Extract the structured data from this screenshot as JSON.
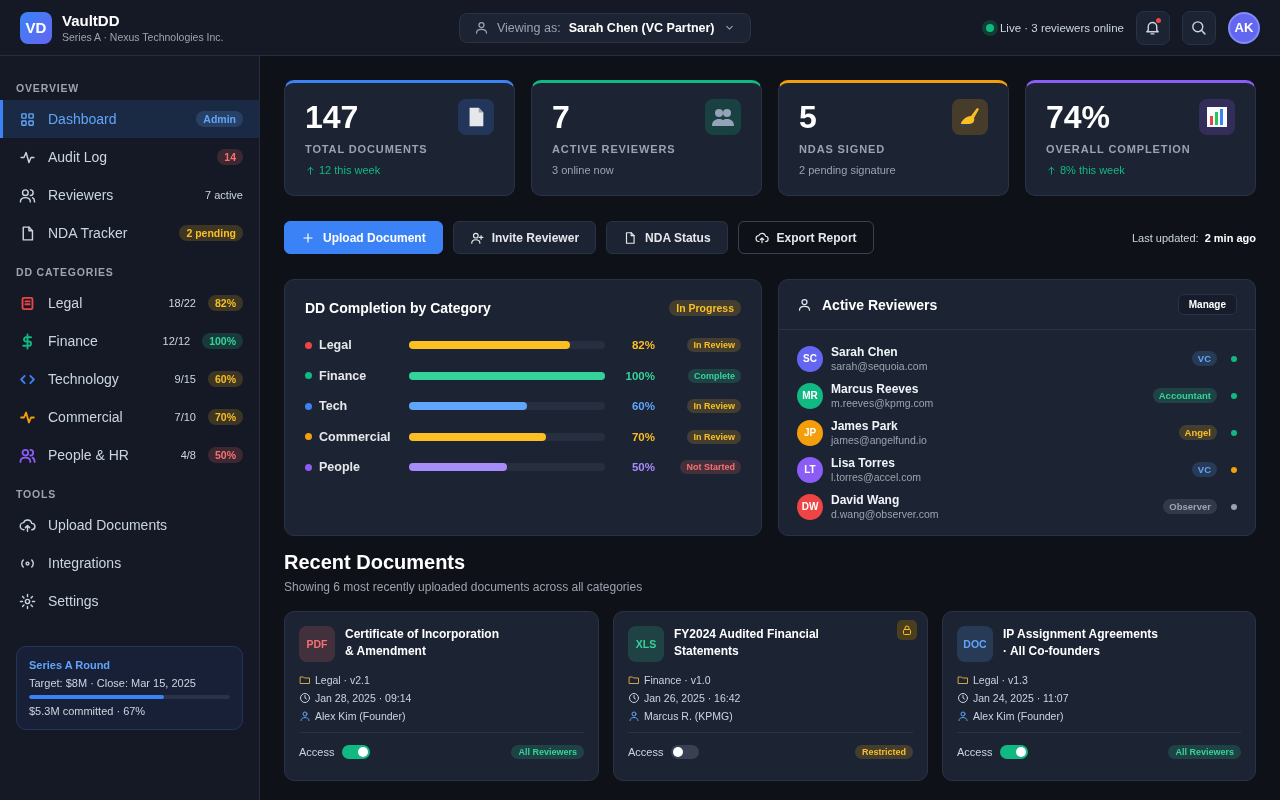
{
  "header": {
    "logo": "VD",
    "app_name": "VaultDD",
    "subtitle": "Series A · Nexus Technologies Inc.",
    "viewing_label": "Viewing as:",
    "viewing_value": "Sarah Chen (VC Partner)",
    "live": "Live · 3 reviewers online",
    "notification_unread": true,
    "avatar": "AK"
  },
  "sidebar": {
    "sections": [
      {
        "title": "OVERVIEW",
        "items": [
          {
            "label": "Dashboard",
            "selected": true,
            "badge": {
              "text": "Admin",
              "kind": "info"
            }
          },
          {
            "label": "Audit Log",
            "selected": false,
            "badge": {
              "text": "14",
              "kind": "danger"
            }
          },
          {
            "label": "Reviewers",
            "selected": false,
            "count": "7 active"
          },
          {
            "label": "NDA Tracker",
            "selected": false,
            "badge": {
              "text": "2 pending",
              "kind": "warning"
            }
          }
        ]
      },
      {
        "title": "DD CATEGORIES",
        "items": [
          {
            "label": "Legal",
            "color": "#ef4444",
            "selected": false,
            "count": "18/22",
            "badge": {
              "text": "82%",
              "kind": "warning"
            }
          },
          {
            "label": "Finance",
            "color": "#10b981",
            "selected": false,
            "count": "12/12",
            "badge": {
              "text": "100%",
              "kind": "success"
            }
          },
          {
            "label": "Technology",
            "color": "#3b82f6",
            "selected": false,
            "count": "9/15",
            "badge": {
              "text": "60%",
              "kind": "warning"
            }
          },
          {
            "label": "Commercial",
            "color": "#f59e0b",
            "selected": false,
            "count": "7/10",
            "badge": {
              "text": "70%",
              "kind": "warning"
            }
          },
          {
            "label": "People & HR",
            "color": "#8b5cf6",
            "selected": false,
            "count": "4/8",
            "badge": {
              "text": "50%",
              "kind": "danger"
            }
          }
        ]
      },
      {
        "title": "TOOLS",
        "items": [
          {
            "label": "Upload Documents",
            "selected": false
          },
          {
            "label": "Integrations",
            "selected": false
          },
          {
            "label": "Settings",
            "selected": false
          }
        ]
      }
    ],
    "round": {
      "title": "Series A Round",
      "details": "Target: $8M · Close: Mar 15, 2025",
      "level": 0.67,
      "committed": "$5.3M committed · 67%"
    }
  },
  "stats": [
    {
      "value": "147",
      "label": "TOTAL DOCUMENTS",
      "note": "12 this week",
      "trend_up": true,
      "color": "#3b82f6"
    },
    {
      "value": "7",
      "label": "ACTIVE REVIEWERS",
      "note": "3 online now",
      "trend_up": false,
      "color": "#10b981"
    },
    {
      "value": "5",
      "label": "NDAS SIGNED",
      "note": "2 pending signature",
      "trend_up": false,
      "color": "#f59e0b"
    },
    {
      "value": "74%",
      "label": "OVERALL COMPLETION",
      "note": "8% this week",
      "trend_up": true,
      "color": "#8b5cf6"
    }
  ],
  "actions": [
    {
      "label": "Upload Document",
      "kind": "primary"
    },
    {
      "label": "Invite Reviewer",
      "kind": "secondary"
    },
    {
      "label": "NDA Status",
      "kind": "secondary"
    },
    {
      "label": "Export Report",
      "kind": "outline"
    }
  ],
  "last_updated": {
    "label": "Last updated:",
    "value": "2 min ago"
  },
  "completion": {
    "title": "DD Completion by Category",
    "status": {
      "text": "In Progress",
      "kind": "warning"
    },
    "rows": [
      {
        "name": "Legal",
        "color": "#ef4444",
        "bar": {
          "level": 0.82,
          "color": "#fbbf24"
        },
        "percent": "82%",
        "status": {
          "text": "In Review",
          "kind": "warning"
        }
      },
      {
        "name": "Finance",
        "color": "#10b981",
        "bar": {
          "level": 1.0,
          "color": "#34d399"
        },
        "percent": "100%",
        "status": {
          "text": "Complete",
          "kind": "success"
        }
      },
      {
        "name": "Tech",
        "color": "#3b82f6",
        "bar": {
          "level": 0.6,
          "color": "#60a5fa"
        },
        "percent": "60%",
        "status": {
          "text": "In Review",
          "kind": "warning"
        }
      },
      {
        "name": "Commercial",
        "color": "#f59e0b",
        "bar": {
          "level": 0.7,
          "color": "#fbbf24"
        },
        "percent": "70%",
        "status": {
          "text": "In Review",
          "kind": "warning"
        }
      },
      {
        "name": "People",
        "color": "#8b5cf6",
        "bar": {
          "level": 0.5,
          "color": "#a78bfa"
        },
        "percent": "50%",
        "status": {
          "text": "Not Started",
          "kind": "danger"
        }
      }
    ]
  },
  "reviewers": {
    "title": "Active Reviewers",
    "manage": "Manage",
    "rows": [
      {
        "initials": "SC",
        "name": "Sarah Chen",
        "email": "sarah@sequoia.com",
        "role": {
          "text": "VC",
          "kind": "info"
        },
        "color": "#6366f1",
        "presence": {
          "color": "#10b981"
        }
      },
      {
        "initials": "MR",
        "name": "Marcus Reeves",
        "email": "m.reeves@kpmg.com",
        "role": {
          "text": "Accountant",
          "kind": "success"
        },
        "color": "#10b981",
        "presence": {
          "color": "#10b981"
        }
      },
      {
        "initials": "JP",
        "name": "James Park",
        "email": "james@angelfund.io",
        "role": {
          "text": "Angel",
          "kind": "warning"
        },
        "color": "#f59e0b",
        "presence": {
          "color": "#10b981"
        }
      },
      {
        "initials": "LT",
        "name": "Lisa Torres",
        "email": "l.torres@accel.com",
        "role": {
          "text": "VC",
          "kind": "info"
        },
        "color": "#8b5cf6",
        "presence": {
          "color": "#f59e0b"
        }
      },
      {
        "initials": "DW",
        "name": "David Wang",
        "email": "d.wang@observer.com",
        "role": {
          "text": "Observer",
          "kind": "neutral"
        },
        "color": "#ef4444",
        "presence": {
          "color": "#9ca3af"
        }
      }
    ]
  },
  "recent": {
    "title": "Recent Documents",
    "subtitle": "Showing 6 most recently uploaded documents across all categories",
    "documents": [
      {
        "type": {
          "text": "PDF",
          "kind": "danger"
        },
        "title_lines": [
          "Certificate of Incorporation",
          "& Amendment"
        ],
        "locked": false,
        "category": "Legal · v2.1",
        "date": "Jan 28, 2025 · 09:14",
        "author": "Alex Kim (Founder)",
        "access_label": "Access",
        "access_on": true,
        "audience": {
          "text": "All Reviewers",
          "kind": "success"
        }
      },
      {
        "type": {
          "text": "XLS",
          "kind": "success"
        },
        "title_lines": [
          "FY2024 Audited Financial",
          "Statements"
        ],
        "locked": true,
        "category": "Finance · v1.0",
        "date": "Jan 26, 2025 · 16:42",
        "author": "Marcus R. (KPMG)",
        "access_label": "Access",
        "access_on": false,
        "audience": {
          "text": "Restricted",
          "kind": "warning"
        }
      },
      {
        "type": {
          "text": "DOC",
          "kind": "info"
        },
        "title_lines": [
          "IP Assignment Agreements",
          "· All Co-founders"
        ],
        "locked": false,
        "category": "Legal · v1.3",
        "date": "Jan 24, 2025 · 11:07",
        "author": "Alex Kim (Founder)",
        "access_label": "Access",
        "access_on": true,
        "audience": {
          "text": "All Reviewers",
          "kind": "success"
        }
      }
    ]
  }
}
